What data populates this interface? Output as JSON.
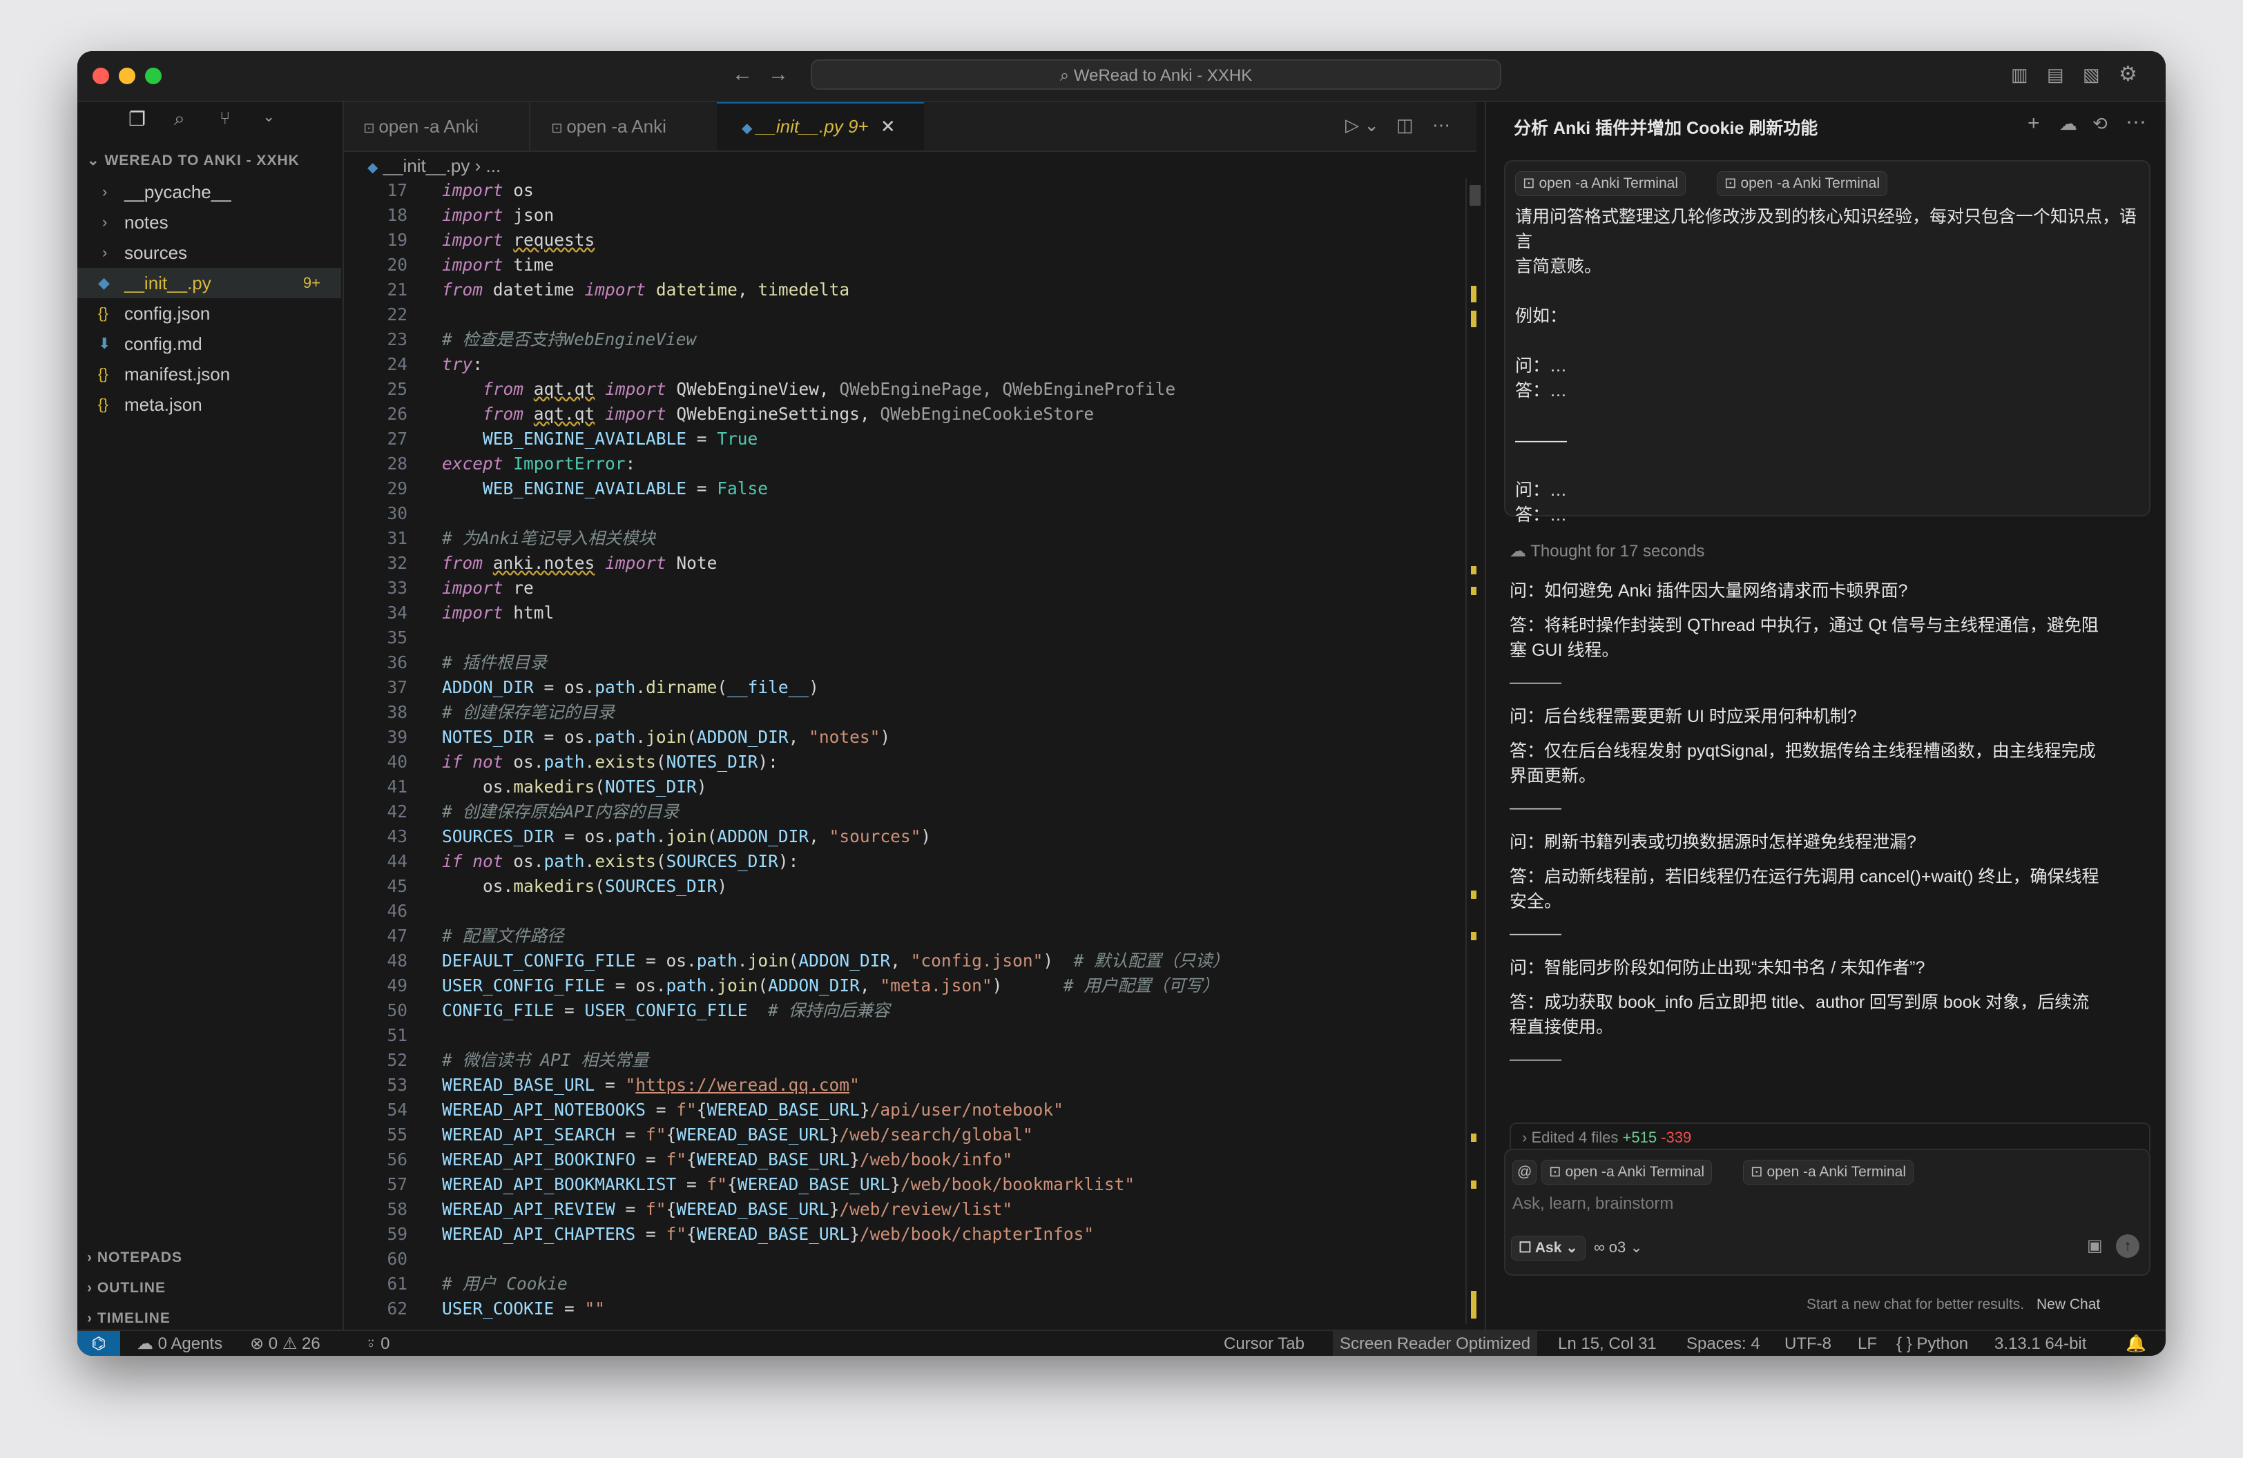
{
  "window": {
    "title": "WeRead to Anki - XXHK"
  },
  "explorer": {
    "section_title": "WEREAD TO ANKI - XXHK",
    "items": [
      {
        "name": "__pycache__",
        "kind": "folder"
      },
      {
        "name": "notes",
        "kind": "folder"
      },
      {
        "name": "sources",
        "kind": "folder"
      },
      {
        "name": "__init__.py",
        "kind": "python",
        "badge": "9+"
      },
      {
        "name": "config.json",
        "kind": "json"
      },
      {
        "name": "config.md",
        "kind": "markdown"
      },
      {
        "name": "manifest.json",
        "kind": "json"
      },
      {
        "name": "meta.json",
        "kind": "json"
      }
    ],
    "bottom_sections": [
      "NOTEPADS",
      "OUTLINE",
      "TIMELINE"
    ]
  },
  "tabs": [
    {
      "label": "open -a Anki",
      "active": false
    },
    {
      "label": "open -a Anki",
      "active": false
    },
    {
      "label": "__init__.py",
      "badge": "9+",
      "active": true
    }
  ],
  "breadcrumb": [
    "__init__.py",
    "..."
  ],
  "code_lines": [
    {
      "n": "17",
      "html": "<span class='k'>import</span> os"
    },
    {
      "n": "18",
      "html": "<span class='k'>import</span> json"
    },
    {
      "n": "19",
      "html": "<span class='k'>import</span> <span class='u'>requests</span>"
    },
    {
      "n": "20",
      "html": "<span class='k'>import</span> time"
    },
    {
      "n": "21",
      "html": "<span class='k'>from</span> datetime <span class='k'>import</span> <span class='fn'>datetime</span>, <span class='fn'>timedelta</span>"
    },
    {
      "n": "22",
      "html": ""
    },
    {
      "n": "23",
      "html": "<span class='c'># 检查是否支持WebEngineView</span>"
    },
    {
      "n": "24",
      "html": "<span class='k'>try</span>:"
    },
    {
      "n": "25",
      "html": "    <span class='k'>from</span> <span class='u'>aqt.qt</span> <span class='k'>import</span> QWebEngineView, <span style='color:#a0a0a0'>QWebEnginePage, QWebEngineProfile</span>"
    },
    {
      "n": "26",
      "html": "    <span class='k'>from</span> <span class='u'>aqt.qt</span> <span class='k'>import</span> QWebEngineSettings, <span style='color:#a0a0a0'>QWebEngineCookieStore</span>"
    },
    {
      "n": "27",
      "html": "    <span class='v'>WEB_ENGINE_AVAILABLE</span> = <span class='cls'>True</span>"
    },
    {
      "n": "28",
      "html": "<span class='k'>except</span> <span class='cls'>ImportError</span>:"
    },
    {
      "n": "29",
      "html": "    <span class='v'>WEB_ENGINE_AVAILABLE</span> = <span class='cls'>False</span>"
    },
    {
      "n": "30",
      "html": ""
    },
    {
      "n": "31",
      "html": "<span class='c'># 为Anki笔记导入相关模块</span>"
    },
    {
      "n": "32",
      "html": "<span class='k'>from</span> <span class='u'>anki.notes</span> <span class='k'>import</span> Note"
    },
    {
      "n": "33",
      "html": "<span class='k'>import</span> re"
    },
    {
      "n": "34",
      "html": "<span class='k'>import</span> html"
    },
    {
      "n": "35",
      "html": ""
    },
    {
      "n": "36",
      "html": "<span class='c'># 插件根目录</span>"
    },
    {
      "n": "37",
      "html": "<span class='v'>ADDON_DIR</span> = os.<span class='v'>path</span>.<span class='fn'>dirname</span>(<span class='v'>__file__</span>)"
    },
    {
      "n": "38",
      "html": "<span class='c'># 创建保存笔记的目录</span>"
    },
    {
      "n": "39",
      "html": "<span class='v'>NOTES_DIR</span> = os.<span class='v'>path</span>.<span class='fn'>join</span>(<span class='v'>ADDON_DIR</span>, <span class='s'>\"notes\"</span>)"
    },
    {
      "n": "40",
      "html": "<span class='k'>if not</span> os.<span class='v'>path</span>.<span class='fn'>exists</span>(<span class='v'>NOTES_DIR</span>):"
    },
    {
      "n": "41",
      "html": "    os.<span class='fn'>makedirs</span>(<span class='v'>NOTES_DIR</span>)"
    },
    {
      "n": "42",
      "html": "<span class='c'># 创建保存原始API内容的目录</span>"
    },
    {
      "n": "43",
      "html": "<span class='v'>SOURCES_DIR</span> = os.<span class='v'>path</span>.<span class='fn'>join</span>(<span class='v'>ADDON_DIR</span>, <span class='s'>\"sources\"</span>)"
    },
    {
      "n": "44",
      "html": "<span class='k'>if not</span> os.<span class='v'>path</span>.<span class='fn'>exists</span>(<span class='v'>SOURCES_DIR</span>):"
    },
    {
      "n": "45",
      "html": "    os.<span class='fn'>makedirs</span>(<span class='v'>SOURCES_DIR</span>)"
    },
    {
      "n": "46",
      "html": ""
    },
    {
      "n": "47",
      "html": "<span class='c'># 配置文件路径</span>"
    },
    {
      "n": "48",
      "html": "<span class='v'>DEFAULT_CONFIG_FILE</span> = os.<span class='v'>path</span>.<span class='fn'>join</span>(<span class='v'>ADDON_DIR</span>, <span class='s'>\"config.json\"</span>)  <span class='c'># 默认配置（只读）</span>"
    },
    {
      "n": "49",
      "html": "<span class='v'>USER_CONFIG_FILE</span> = os.<span class='v'>path</span>.<span class='fn'>join</span>(<span class='v'>ADDON_DIR</span>, <span class='s'>\"meta.json\"</span>)      <span class='c'># 用户配置（可写）</span>"
    },
    {
      "n": "50",
      "html": "<span class='v'>CONFIG_FILE</span> = <span class='v'>USER_CONFIG_FILE</span>  <span class='c'># 保持向后兼容</span>"
    },
    {
      "n": "51",
      "html": ""
    },
    {
      "n": "52",
      "html": "<span class='c'># 微信读书 API 相关常量</span>"
    },
    {
      "n": "53",
      "html": "<span class='v'>WEREAD_BASE_URL</span> = <span class='s'>\"<u>https://weread.qq.com</u>\"</span>"
    },
    {
      "n": "54",
      "html": "<span class='v'>WEREAD_API_NOTEBOOKS</span> = <span class='s'>f\"</span>{<span class='v'>WEREAD_BASE_URL</span>}<span class='s'>/api/user/notebook\"</span>"
    },
    {
      "n": "55",
      "html": "<span class='v'>WEREAD_API_SEARCH</span> = <span class='s'>f\"</span>{<span class='v'>WEREAD_BASE_URL</span>}<span class='s'>/web/search/global\"</span>"
    },
    {
      "n": "56",
      "html": "<span class='v'>WEREAD_API_BOOKINFO</span> = <span class='s'>f\"</span>{<span class='v'>WEREAD_BASE_URL</span>}<span class='s'>/web/book/info\"</span>"
    },
    {
      "n": "57",
      "html": "<span class='v'>WEREAD_API_BOOKMARKLIST</span> = <span class='s'>f\"</span>{<span class='v'>WEREAD_BASE_URL</span>}<span class='s'>/web/book/bookmarklist\"</span>"
    },
    {
      "n": "58",
      "html": "<span class='v'>WEREAD_API_REVIEW</span> = <span class='s'>f\"</span>{<span class='v'>WEREAD_BASE_URL</span>}<span class='s'>/web/review/list\"</span>"
    },
    {
      "n": "59",
      "html": "<span class='v'>WEREAD_API_CHAPTERS</span> = <span class='s'>f\"</span>{<span class='v'>WEREAD_BASE_URL</span>}<span class='s'>/web/book/chapterInfos\"</span>"
    },
    {
      "n": "60",
      "html": ""
    },
    {
      "n": "61",
      "html": "<span class='c'># 用户 Cookie</span>"
    },
    {
      "n": "62",
      "html": "<span class='v'>USER_COOKIE</span> = <span class='s'>\"\"</span>"
    }
  ],
  "chat": {
    "title": "分析 Anki 插件并增加 Cookie 刷新功能",
    "context_chips": [
      "open -a Anki Terminal",
      "open -a Anki Terminal"
    ],
    "user_message": [
      "请用问答格式整理这几轮修改涉及到的核心知识经验，每对只包含一个知识点，语言",
      "言简意赅。",
      "",
      "例如：",
      "",
      "问：…",
      "答：…",
      "",
      "———",
      "",
      "问：…",
      "答：…"
    ],
    "thought": "Thought for 17 seconds",
    "qa": [
      {
        "q": "问：如何避免 Anki 插件因大量网络请求而卡顿界面?",
        "a": [
          "答：将耗时操作封装到 QThread 中执行，通过 Qt 信号与主线程通信，避免阻",
          "塞 GUI 线程。"
        ]
      },
      {
        "q": "问：后台线程需要更新 UI 时应采用何种机制?",
        "a": [
          "答：仅在后台线程发射 pyqtSignal，把数据传给主线程槽函数，由主线程完成",
          "界面更新。"
        ]
      },
      {
        "q": "问：刷新书籍列表或切换数据源时怎样避免线程泄漏?",
        "a": [
          "答：启动新线程前，若旧线程仍在运行先调用 cancel()+wait() 终止，确保线程",
          "安全。"
        ]
      },
      {
        "q": "问：智能同步阶段如何防止出现“未知书名 / 未知作者”?",
        "a": [
          "答：成功获取 book_info 后立即把 title、author 回写到原 book 对象，后续流",
          "程直接使用。"
        ]
      }
    ],
    "separator": "———",
    "edited": {
      "label": "Edited 4 files",
      "added": "+515",
      "removed": "-339"
    },
    "input_placeholder": "Ask, learn, brainstorm",
    "mode": "Ask",
    "model": "o3",
    "footer_hint": "Start a new chat for better results.",
    "new_chat": "New Chat"
  },
  "status": {
    "agents": "0 Agents",
    "errors": "0",
    "warnings": "26",
    "ports": "0",
    "cursor_tab": "Cursor Tab",
    "screen_reader": "Screen Reader Optimized",
    "position": "Ln 15, Col 31",
    "spaces": "Spaces: 4",
    "encoding": "UTF-8",
    "eol": "LF",
    "language": "Python",
    "interpreter": "3.13.1 64-bit"
  },
  "colors": {
    "accent": "#0e639c",
    "warning": "#d7ba3a",
    "added": "#73c991",
    "removed": "#f14c4c"
  }
}
